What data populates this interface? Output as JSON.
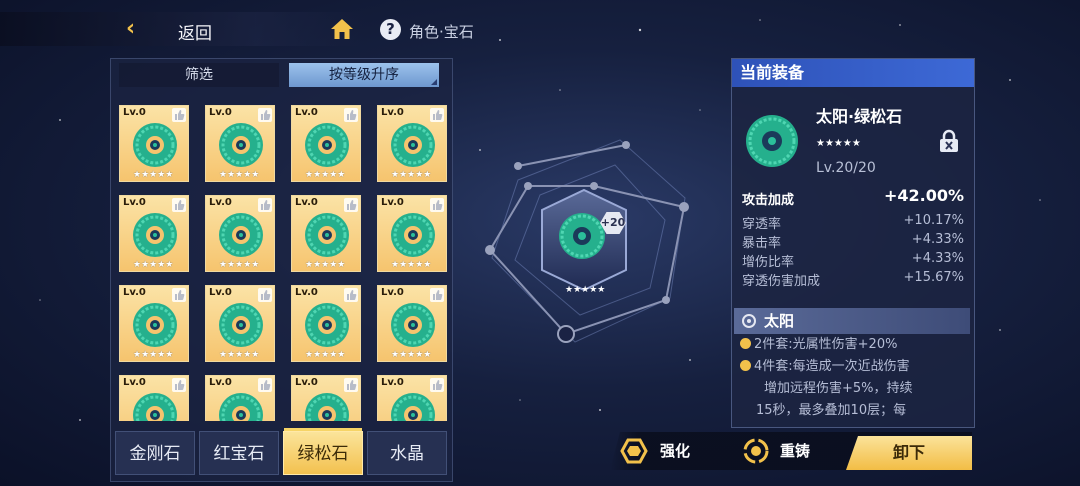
{
  "topbar": {
    "back_label": "返回",
    "back_icon": "chevron-left-icon",
    "home_icon": "home-icon",
    "help_icon": "question-icon",
    "help_glyph": "?",
    "breadcrumb": "角色·宝石"
  },
  "left_panel": {
    "filter_label": "筛选",
    "sort_label": "按等级升序",
    "cards": [
      {
        "level": "Lv.0",
        "stars": "★★★★★"
      },
      {
        "level": "Lv.0",
        "stars": "★★★★★"
      },
      {
        "level": "Lv.0",
        "stars": "★★★★★"
      },
      {
        "level": "Lv.0",
        "stars": "★★★★★"
      },
      {
        "level": "Lv.0",
        "stars": "★★★★★"
      },
      {
        "level": "Lv.0",
        "stars": "★★★★★"
      },
      {
        "level": "Lv.0",
        "stars": "★★★★★"
      },
      {
        "level": "Lv.0",
        "stars": "★★★★★"
      },
      {
        "level": "Lv.0",
        "stars": "★★★★★"
      },
      {
        "level": "Lv.0",
        "stars": "★★★★★"
      },
      {
        "level": "Lv.0",
        "stars": "★★★★★"
      },
      {
        "level": "Lv.0",
        "stars": "★★★★★"
      },
      {
        "level": "Lv.0",
        "stars": "★★★★★"
      },
      {
        "level": "Lv.0",
        "stars": "★★★★★"
      },
      {
        "level": "Lv.0",
        "stars": "★★★★★"
      },
      {
        "level": "Lv.0",
        "stars": "★★★★★"
      }
    ],
    "categories": [
      {
        "label": "金刚石",
        "active": false
      },
      {
        "label": "红宝石",
        "active": false
      },
      {
        "label": "绿松石",
        "active": true
      },
      {
        "label": "水晶",
        "active": false
      }
    ]
  },
  "center": {
    "plus_badge": "+20",
    "stars": "★★★★★"
  },
  "right_panel": {
    "header": "当前装备",
    "gem_name": "太阳·绿松石",
    "stars": "★★★★★",
    "level": "Lv.20/20",
    "lock_icon": "lock-icon",
    "main_stat": {
      "label": "攻击加成",
      "value": "+42.00%"
    },
    "sub_stats": [
      {
        "label": "穿透率",
        "value": "+10.17%"
      },
      {
        "label": "暴击率",
        "value": "+4.33%"
      },
      {
        "label": "增伤比率",
        "value": "+4.33%"
      },
      {
        "label": "穿透伤害加成",
        "value": "+15.67%"
      }
    ],
    "set_name": "太阳",
    "set_lines": [
      "2件套:光属性伤害+20%",
      "4件套:每造成一次近战伤害",
      "增加远程伤害+5%，持续",
      "15秒，最多叠加10层；每"
    ]
  },
  "actions": {
    "enhance_label": "强化",
    "reforge_label": "重铸",
    "unload_label": "卸下"
  },
  "colors": {
    "accent_gold": "#f2c14b",
    "card_bg": "#f6c46e",
    "gem_green": "#2bbf9a",
    "header_blue": "#3d69d6"
  }
}
